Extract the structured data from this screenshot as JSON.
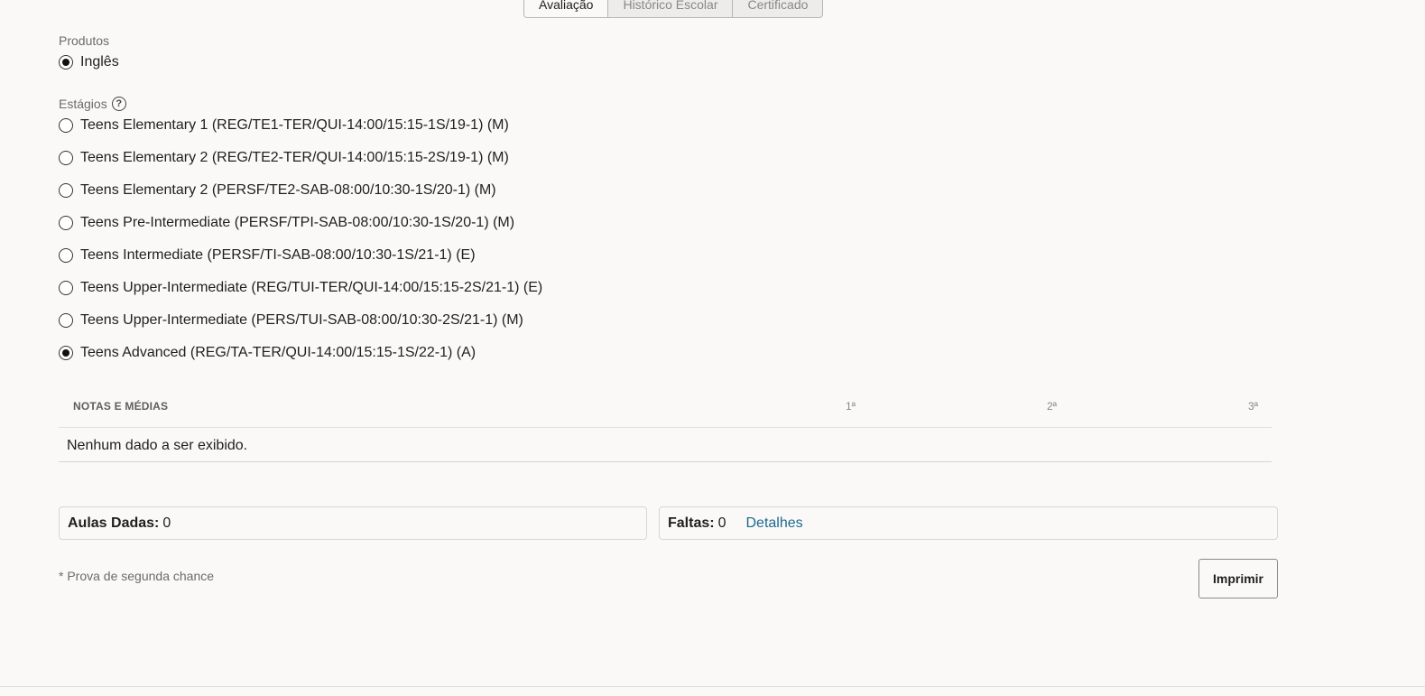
{
  "tabs": [
    {
      "label": "Avaliação",
      "active": true
    },
    {
      "label": "Histórico Escolar",
      "active": false
    },
    {
      "label": "Certificado",
      "active": false
    }
  ],
  "produtos": {
    "label": "Produtos",
    "options": [
      {
        "label": "Inglês",
        "checked": true
      }
    ]
  },
  "estagios": {
    "label": "Estágios",
    "options": [
      {
        "label": "Teens Elementary 1 (REG/TE1-TER/QUI-14:00/15:15-1S/19-1) (M)",
        "checked": false
      },
      {
        "label": "Teens Elementary 2 (REG/TE2-TER/QUI-14:00/15:15-2S/19-1) (M)",
        "checked": false
      },
      {
        "label": "Teens Elementary 2 (PERSF/TE2-SAB-08:00/10:30-1S/20-1) (M)",
        "checked": false
      },
      {
        "label": "Teens Pre-Intermediate (PERSF/TPI-SAB-08:00/10:30-1S/20-1) (M)",
        "checked": false
      },
      {
        "label": "Teens Intermediate (PERSF/TI-SAB-08:00/10:30-1S/21-1) (E)",
        "checked": false
      },
      {
        "label": "Teens Upper-Intermediate (REG/TUI-TER/QUI-14:00/15:15-2S/21-1) (E)",
        "checked": false
      },
      {
        "label": "Teens Upper-Intermediate (PERS/TUI-SAB-08:00/10:30-2S/21-1) (M)",
        "checked": false
      },
      {
        "label": "Teens Advanced (REG/TA-TER/QUI-14:00/15:15-1S/22-1) (A)",
        "checked": true
      }
    ]
  },
  "grid": {
    "title": "NOTAS E MÉDIAS",
    "columns": [
      "1ª",
      "2ª",
      "3ª"
    ],
    "empty_message": "Nenhum dado a ser exibido."
  },
  "summary": {
    "aulas_label": "Aulas Dadas:",
    "aulas_value": "0",
    "faltas_label": "Faltas:",
    "faltas_value": "0",
    "details_link": "Detalhes"
  },
  "footnote": "* Prova de segunda chance",
  "print_button": "Imprimir"
}
